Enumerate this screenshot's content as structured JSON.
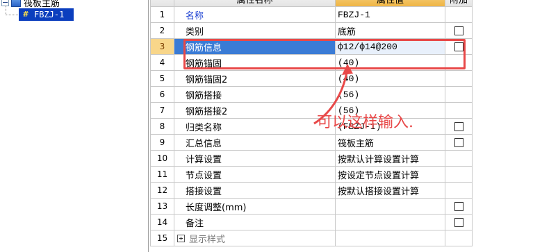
{
  "tree": {
    "root_label": "筏板主筋",
    "child_label": "FBZJ-1",
    "child_icon": "#"
  },
  "grid": {
    "header": {
      "name": "属性名称",
      "value": "属性值",
      "add": "附加"
    },
    "rows": [
      {
        "num": "1",
        "name": "名称",
        "value": "FBZJ-1",
        "checkbox": false,
        "blue_name": true
      },
      {
        "num": "2",
        "name": "类别",
        "value": "底筋",
        "checkbox": true
      },
      {
        "num": "3",
        "name": "钢筋信息",
        "value": "ф12/ф14@200",
        "checkbox": true,
        "selected": true
      },
      {
        "num": "4",
        "name": "钢筋锚固",
        "value": "(40)",
        "checkbox": false
      },
      {
        "num": "5",
        "name": "钢筋锚固2",
        "value": "(40)",
        "checkbox": false
      },
      {
        "num": "6",
        "name": "钢筋搭接",
        "value": "(56)",
        "checkbox": false
      },
      {
        "num": "7",
        "name": "钢筋搭接2",
        "value": "(56)",
        "checkbox": false
      },
      {
        "num": "8",
        "name": "归类名称",
        "value": "(FBZJ-1)",
        "checkbox": true
      },
      {
        "num": "9",
        "name": "汇总信息",
        "value": "筏板主筋",
        "checkbox": true
      },
      {
        "num": "10",
        "name": "计算设置",
        "value": "按默认计算设置计算",
        "checkbox": false
      },
      {
        "num": "11",
        "name": "节点设置",
        "value": "按设定节点设置计算",
        "checkbox": false
      },
      {
        "num": "12",
        "name": "搭接设置",
        "value": "按默认搭接设置计算",
        "checkbox": false
      },
      {
        "num": "13",
        "name": "长度调整(mm)",
        "value": "",
        "checkbox": true
      },
      {
        "num": "14",
        "name": "备注",
        "value": "",
        "checkbox": true
      },
      {
        "num": "15",
        "name": "显示样式",
        "value": "",
        "checkbox": false,
        "expandable": true
      }
    ]
  },
  "annotation": {
    "text": "可以这样输入.",
    "color": "#e84848"
  }
}
